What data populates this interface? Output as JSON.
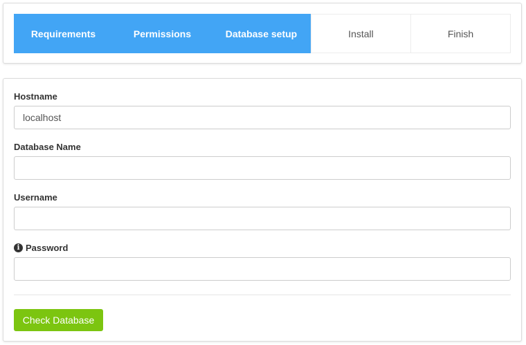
{
  "steps": [
    {
      "label": "Requirements",
      "state": "done"
    },
    {
      "label": "Permissions",
      "state": "done"
    },
    {
      "label": "Database setup",
      "state": "done"
    },
    {
      "label": "Install",
      "state": "todo"
    },
    {
      "label": "Finish",
      "state": "todo"
    }
  ],
  "form": {
    "hostname": {
      "label": "Hostname",
      "value": "localhost"
    },
    "database_name": {
      "label": "Database Name",
      "value": ""
    },
    "username": {
      "label": "Username",
      "value": ""
    },
    "password": {
      "label": "Password",
      "value": "",
      "icon": "info-icon"
    },
    "submit_label": "Check Database"
  },
  "colors": {
    "step_done_bg": "#42a5f5",
    "button_bg": "#7cc510"
  }
}
